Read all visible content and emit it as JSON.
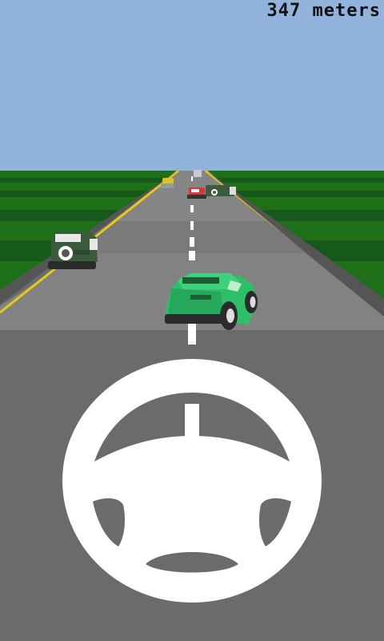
{
  "hud": {
    "distance_value": "347",
    "distance_unit": "meters",
    "distance_text": "347 meters"
  },
  "colors": {
    "sky": "#91b3dc",
    "grass_light": "#1d6f18",
    "grass_dark": "#17591a",
    "road_near": "#6b6b6b",
    "road_mid": "#7a7a7a",
    "road_far": "#858585",
    "edge_line": "#e6c81e",
    "lane_marking": "#ffffff",
    "player_car": "#2fbf6a",
    "wheel": "#ffffff"
  },
  "scene": {
    "player_car": {
      "name": "player-car",
      "color": "#2fbf6a"
    },
    "traffic": [
      {
        "name": "traffic-car-green-left",
        "color": "#3c5a3c"
      },
      {
        "name": "traffic-car-red",
        "color": "#d23a3a"
      },
      {
        "name": "traffic-car-yellow",
        "color": "#e0c020"
      }
    ]
  },
  "controls": {
    "steering_wheel_icon": "steering-wheel-icon"
  }
}
